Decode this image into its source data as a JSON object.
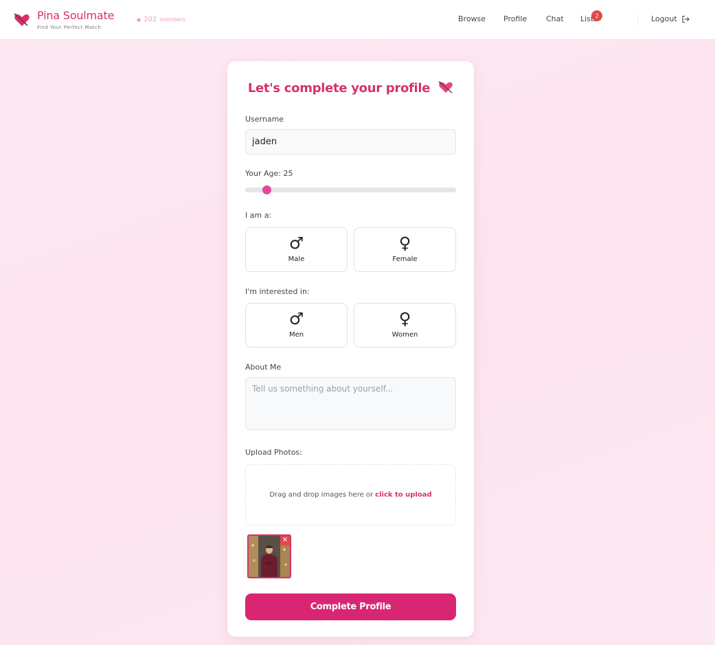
{
  "header": {
    "brand_name": "Pina Soulmate",
    "tagline": "Find Your Perfect Match",
    "members_count": "202",
    "members_label": "members",
    "nav": [
      {
        "label": "Browse"
      },
      {
        "label": "Profile"
      },
      {
        "label": "Chat"
      },
      {
        "label": "Lists"
      }
    ],
    "lists_badge": "2",
    "logout_label": "Logout",
    "logo_icon": "heart-arrow-icon",
    "logout_icon": "logout-icon"
  },
  "form": {
    "title": "Let's complete your profile",
    "title_icon": "heart-arrow-icon",
    "username_label": "Username",
    "username_value": "jaden",
    "age_label": "Your Age: 25",
    "age_value": 25,
    "gender_label": "I am a:",
    "gender_options": [
      {
        "symbol": "♂",
        "label": "Male",
        "icon": "male-icon"
      },
      {
        "symbol": "♀",
        "label": "Female",
        "icon": "female-icon"
      }
    ],
    "interest_label": "I'm interested in:",
    "interest_options": [
      {
        "symbol": "♂",
        "label": "Men",
        "icon": "male-icon"
      },
      {
        "symbol": "♀",
        "label": "Women",
        "icon": "female-icon"
      }
    ],
    "about_label": "About Me",
    "about_placeholder": "Tell us something about yourself...",
    "about_value": "",
    "upload_label": "Upload Photos:",
    "dropzone_text": "Drag and drop images here or",
    "dropzone_link": "click to upload",
    "remove_symbol": "✕",
    "submit_label": "Complete Profile"
  },
  "colors": {
    "brand": "#d6316f",
    "button": "#d92673",
    "slider_thumb": "#e0489a",
    "badge": "#e24a4a",
    "page_bg": "#fce8f2"
  }
}
